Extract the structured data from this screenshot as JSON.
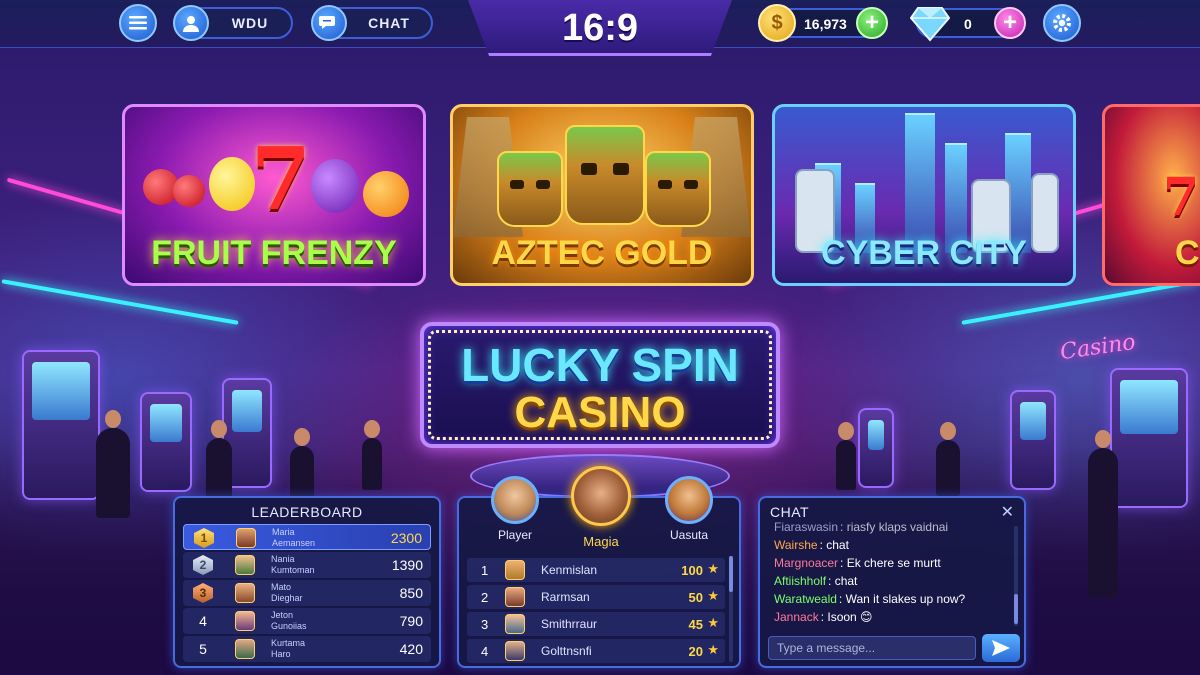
{
  "topbar": {
    "username": "WDU",
    "chat_label": "CHAT",
    "aspect_label": "16:9",
    "coins": "16,973",
    "gems": "0"
  },
  "games": [
    {
      "title": "FRUIT FRENZY"
    },
    {
      "title": "AZTEC GOLD"
    },
    {
      "title": "CYBER CITY"
    },
    {
      "title": "CI"
    }
  ],
  "logo": {
    "line1": "LUCKY SPIN",
    "line2": "CASINO"
  },
  "neon_sign": "Casino",
  "leaderboard": {
    "title": "LEADERBOARD",
    "rows": [
      {
        "rank": "1",
        "first": "Maria",
        "last": "Aemansen",
        "score": "2300"
      },
      {
        "rank": "2",
        "first": "Nania",
        "last": "Kumtoman",
        "score": "1390"
      },
      {
        "rank": "3",
        "first": "Mato",
        "last": "Dieghar",
        "score": "850"
      },
      {
        "rank": "4",
        "first": "Jeton",
        "last": "Gunoiias",
        "score": "790"
      },
      {
        "rank": "5",
        "first": "Kurtama",
        "last": "Haro",
        "score": "420"
      }
    ]
  },
  "players": {
    "featured": [
      {
        "name": "Player"
      },
      {
        "name": "Magia"
      },
      {
        "name": "Uasuta"
      }
    ],
    "rows": [
      {
        "rank": "1",
        "name": "Kenmislan",
        "score": "100"
      },
      {
        "rank": "2",
        "name": "Rarmsan",
        "score": "50"
      },
      {
        "rank": "3",
        "name": "Smithrraur",
        "score": "45"
      },
      {
        "rank": "4",
        "name": "Golttnsnfi",
        "score": "20"
      }
    ]
  },
  "chat": {
    "title": "CHAT",
    "messages": [
      {
        "user": "Fiaraswasin",
        "text": ": riasfy klaps vaidnai",
        "color": "#cfd6ff"
      },
      {
        "user": "Wairshe",
        "text": ": chat",
        "color": "#ffa84a"
      },
      {
        "user": "Margnoacer",
        "text": ": Ek chere se murtt",
        "color": "#ff7a9a"
      },
      {
        "user": "Aftiishholf",
        "text": ": chat",
        "color": "#7aff6a"
      },
      {
        "user": "Waratweald",
        "text": ": Wan it slakes up now?",
        "color": "#7aff6a"
      },
      {
        "user": "Jannack",
        "text": ": Isoon 😊",
        "color": "#ff7a9a"
      }
    ],
    "input_placeholder": "Type a message..."
  },
  "colors": {
    "accent_blue": "#3e5ed8",
    "gold": "#ffd84a",
    "neon_pink": "#ff4bd8",
    "neon_cyan": "#3af0ff"
  },
  "icons": [
    "menu-icon",
    "user-icon",
    "chat-bubble-icon",
    "coin-icon",
    "diamond-icon",
    "gear-icon",
    "star-icon",
    "send-icon",
    "close-icon"
  ]
}
